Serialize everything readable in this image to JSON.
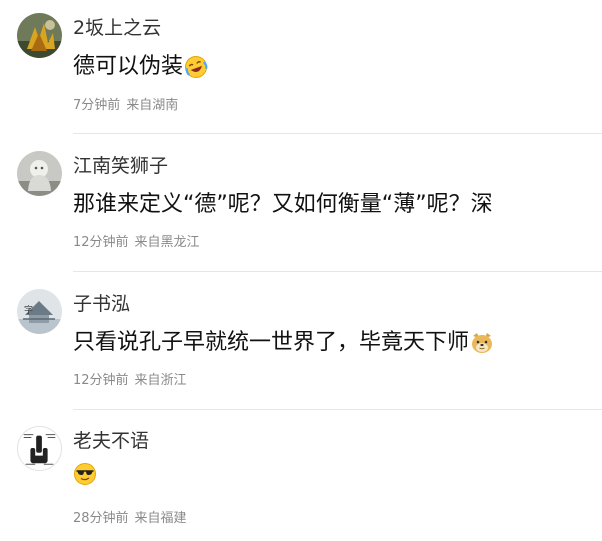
{
  "comments": [
    {
      "username": "2坂上之云",
      "content": "德可以伪装",
      "emoji": "laughing-crying-emoji",
      "time": "7分钟前",
      "location": "来自湖南"
    },
    {
      "username": "江南笑狮子",
      "content": "那谁来定义“德”呢？又如何衡量“薄”呢？深",
      "emoji": "",
      "time": "12分钟前",
      "location": "来自黑龙江"
    },
    {
      "username": "子书泓",
      "content": "只看说孔子早就统一世界了，毕竟天下师",
      "emoji": "doge-emoji",
      "time": "12分钟前",
      "location": "来自浙江"
    },
    {
      "username": "老夫不语",
      "content": "",
      "emoji": "sunglasses-emoji",
      "time": "28分钟前",
      "location": "来自福建"
    }
  ]
}
